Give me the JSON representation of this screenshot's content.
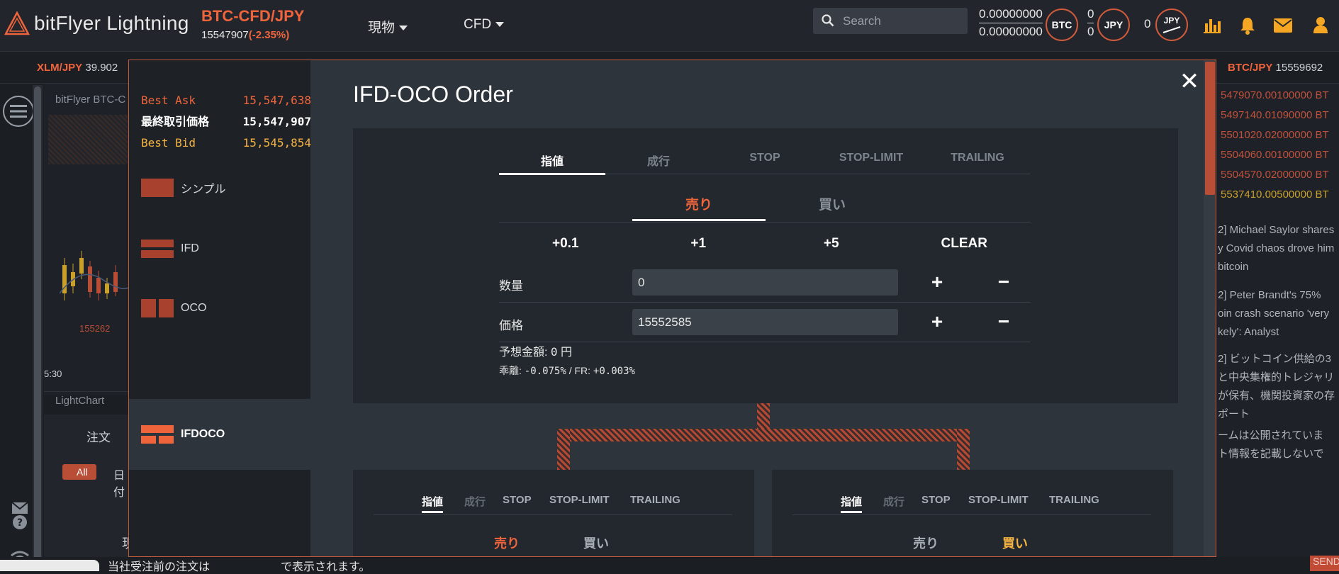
{
  "header": {
    "brand": "bitFlyer Lightning",
    "pair": "BTC-CFD/JPY",
    "price": "15547907",
    "change": "(-2.35%)",
    "nav": [
      {
        "label": "現物"
      },
      {
        "label": "CFD"
      }
    ],
    "search_placeholder": "Search",
    "btc_balance_top": "0.00000000",
    "btc_balance_bottom": "0.00000000",
    "btc_label": "BTC",
    "jpy_top": "0",
    "jpy_bottom": "0",
    "jpy_label": "JPY",
    "gauge_value": "0",
    "gauge_label": "JPY"
  },
  "ticker": {
    "left_pair": "XLM/JPY",
    "left_price": "39.902",
    "right_pair": "BTC/JPY",
    "right_price": "15559692"
  },
  "background": {
    "chart_label": "bitFlyer BTC-C",
    "price_tag": "155262",
    "time_label": "5:30",
    "lightchart": "LightChart",
    "order_tab": "注文",
    "all_chip": "All",
    "date_frag": "日付",
    "ghost_char": "現",
    "bottom_message": "当社受注前の注文は",
    "bottom_message2": "で表示されます。",
    "send": "SEND",
    "orderbook": [
      "5479070.00100000 BT",
      "5497140.01090000 BT",
      "5501020.02000000 BT",
      "5504060.00100000 BT",
      "5504570.02000000 BT",
      "5537410.00500000 BT"
    ],
    "news": [
      "2] Michael Saylor shares",
      "y Covid chaos drove him",
      "bitcoin",
      "",
      "2] Peter Brandt's 75%",
      "oin crash scenario 'very",
      "kely': Analyst",
      "",
      "2] ビットコイン供給の3",
      "と中央集権的トレジャリ",
      "が保有、機関投資家の存",
      "ポート",
      "",
      "ームは公開されていま",
      "ト情報を記載しないで"
    ]
  },
  "modal": {
    "title": "IFD-OCO Order",
    "best": [
      {
        "key": "Best Ask",
        "value": "15,547,638"
      },
      {
        "key": "最終取引価格",
        "value": "15,547,907"
      },
      {
        "key": "Best Bid",
        "value": "15,545,854"
      }
    ],
    "order_types": [
      {
        "label": "シンプル"
      },
      {
        "label": "IFD"
      },
      {
        "label": "OCO"
      },
      {
        "label": "IFDOCO"
      }
    ],
    "main_tabs": [
      {
        "label": "指値"
      },
      {
        "label": "成行"
      },
      {
        "label": "STOP"
      },
      {
        "label": "STOP-LIMIT"
      },
      {
        "label": "TRAILING"
      }
    ],
    "sell_label": "売り",
    "buy_label": "買い",
    "increments": [
      "+0.1",
      "+1",
      "+5",
      "CLEAR"
    ],
    "qty_label": "数量",
    "qty_value": "0",
    "price_label": "価格",
    "price_value": "15552585",
    "estimate_label": "予想金額:",
    "estimate_value": "0",
    "estimate_unit": "円",
    "deviation_label": "乖離:",
    "deviation_value": "-0.075%",
    "fr_label": "/ FR:",
    "fr_value": "+0.003%",
    "sub_tabs": [
      {
        "label": "指値"
      },
      {
        "label": "成行"
      },
      {
        "label": "STOP"
      },
      {
        "label": "STOP-LIMIT"
      },
      {
        "label": "TRAILING"
      }
    ]
  },
  "colors": {
    "accent": "#f0643c",
    "bid": "#f5b342",
    "modal_bg": "#2d343b"
  }
}
